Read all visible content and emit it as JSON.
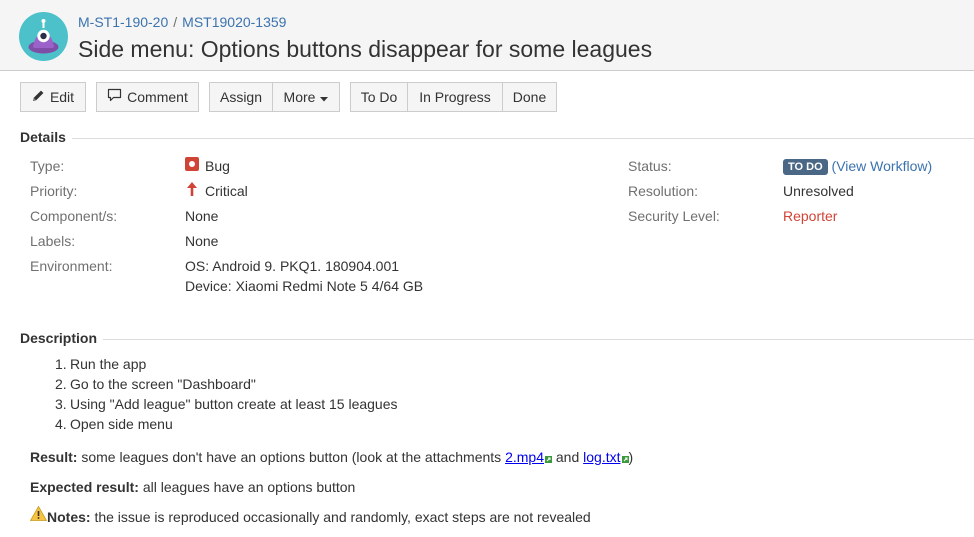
{
  "header": {
    "breadcrumb_project": "M-ST1-190-20",
    "breadcrumb_separator": "/",
    "breadcrumb_issue": "MST19020-1359",
    "summary": "Side menu: Options buttons disappear for some leagues"
  },
  "toolbar": {
    "edit": "Edit",
    "comment": "Comment",
    "assign": "Assign",
    "more": "More",
    "todo": "To Do",
    "in_progress": "In Progress",
    "done": "Done"
  },
  "details": {
    "heading": "Details",
    "type_label": "Type:",
    "type_value": "Bug",
    "priority_label": "Priority:",
    "priority_value": "Critical",
    "components_label": "Component/s:",
    "components_value": "None",
    "labels_label": "Labels:",
    "labels_value": "None",
    "environment_label": "Environment:",
    "environment_line1": "OS: Android 9. PKQ1. 180904.001",
    "environment_line2": "Device: Xiaomi Redmi Note 5 4/64 GB",
    "status_label": "Status:",
    "status_value": "TO DO",
    "view_workflow_open": "(",
    "view_workflow": "View Workflow",
    "view_workflow_close": ")",
    "resolution_label": "Resolution:",
    "resolution_value": "Unresolved",
    "security_label": "Security Level:",
    "security_value": "Reporter"
  },
  "description": {
    "heading": "Description",
    "steps": [
      {
        "num": "1.",
        "text": "Run the app"
      },
      {
        "num": "2.",
        "text": "Go to the screen \"Dashboard\""
      },
      {
        "num": "3.",
        "text": "Using \"Add league\" button create at least 15 leagues"
      },
      {
        "num": "4.",
        "text": "Open side menu"
      }
    ],
    "result_label": "Result:",
    "result_text": "some leagues don't have an options button (look at the attachments",
    "attachment_1": "2.mp4",
    "result_and": "and",
    "attachment_2": "log.txt",
    "result_close": ")",
    "expected_label": "Expected result:",
    "expected_text": "all leagues have an options button",
    "notes_label": "Notes:",
    "notes_text": "the issue is reproduced occasionally and randomly, exact steps are not revealed"
  },
  "colors": {
    "link": "#3b73af",
    "lozenge": "#4a6785",
    "reporter": "#d04437",
    "bug": "#d04437",
    "critical": "#d04437"
  },
  "icons": {
    "avatar": "project-avatar-icon",
    "edit": "pencil-icon",
    "comment": "comment-bubble-icon",
    "more": "caret-down-icon",
    "bug": "bug-icon",
    "priority": "critical-arrow-up-icon",
    "attachment": "attachment-link-icon",
    "warning": "warning-icon"
  }
}
